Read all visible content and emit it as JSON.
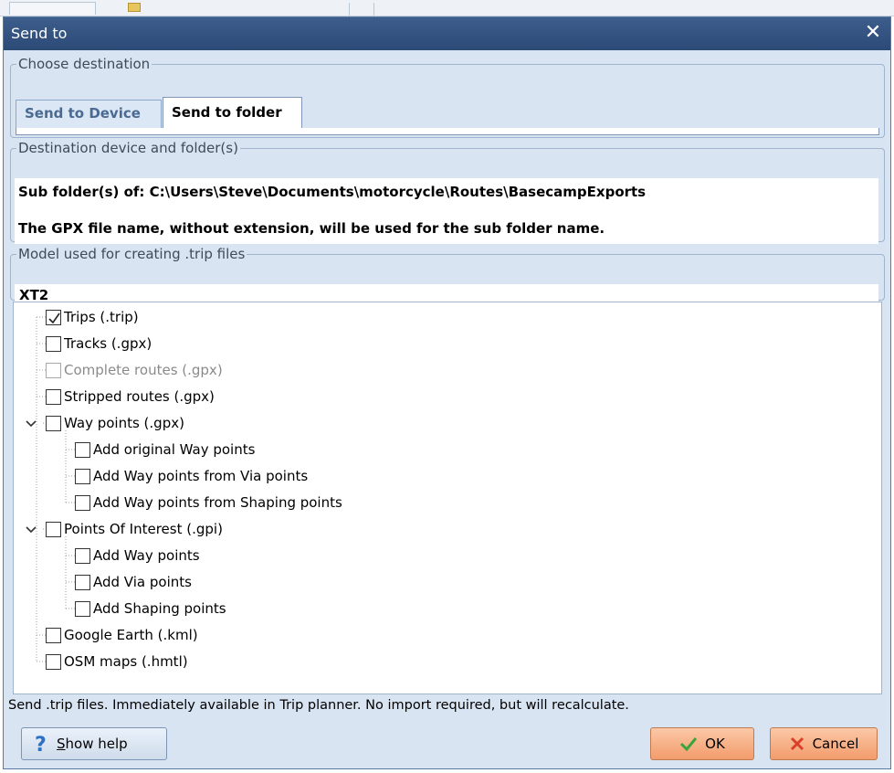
{
  "dialog": {
    "title": "Send to",
    "close_symbol": "✕"
  },
  "choose_destination": {
    "legend": "Choose destination",
    "tabs": [
      {
        "label": "Send to Device"
      },
      {
        "label": "Send to folder"
      }
    ]
  },
  "destination": {
    "legend": "Destination device and folder(s)",
    "line1": "Sub folder(s) of: C:\\Users\\Steve\\Documents\\motorcycle\\Routes\\BasecampExports",
    "line2": "The GPX file name, without extension, will be used for the sub folder name."
  },
  "model": {
    "legend": "Model used for creating .trip files",
    "value": "XT2"
  },
  "tree": {
    "items": [
      {
        "label": "Trips (.trip)",
        "checked": true
      },
      {
        "label": "Tracks (.gpx)",
        "checked": false
      },
      {
        "label": "Complete routes (.gpx)",
        "checked": false,
        "disabled": true
      },
      {
        "label": "Stripped routes (.gpx)",
        "checked": false
      },
      {
        "label": "Way points (.gpx)",
        "checked": false,
        "expanded": true,
        "children": [
          {
            "label": "Add original Way points",
            "checked": false
          },
          {
            "label": "Add Way points from Via points",
            "checked": false
          },
          {
            "label": "Add Way points from Shaping points",
            "checked": false
          }
        ]
      },
      {
        "label": "Points Of Interest (.gpi)",
        "checked": false,
        "expanded": true,
        "children": [
          {
            "label": "Add Way points",
            "checked": false
          },
          {
            "label": "Add Via points",
            "checked": false
          },
          {
            "label": "Add Shaping points",
            "checked": false
          }
        ]
      },
      {
        "label": "Google Earth (.kml)",
        "checked": false
      },
      {
        "label": "OSM maps (.hmtl)",
        "checked": false
      }
    ]
  },
  "status_text": "Send .trip files. Immediately available in Trip planner. No import required, but will recalculate.",
  "buttons": {
    "help_mnemonic": "S",
    "help_rest": "how help",
    "ok": "OK",
    "cancel": "Cancel"
  },
  "colors": {
    "titlebar": "#2c4a76",
    "dialog_bg": "#d8e4f2",
    "accent_button": "#f39c6b",
    "ok_icon": "#3aa53a",
    "cancel_icon": "#d9402b",
    "help_icon": "#2f6fc4"
  }
}
